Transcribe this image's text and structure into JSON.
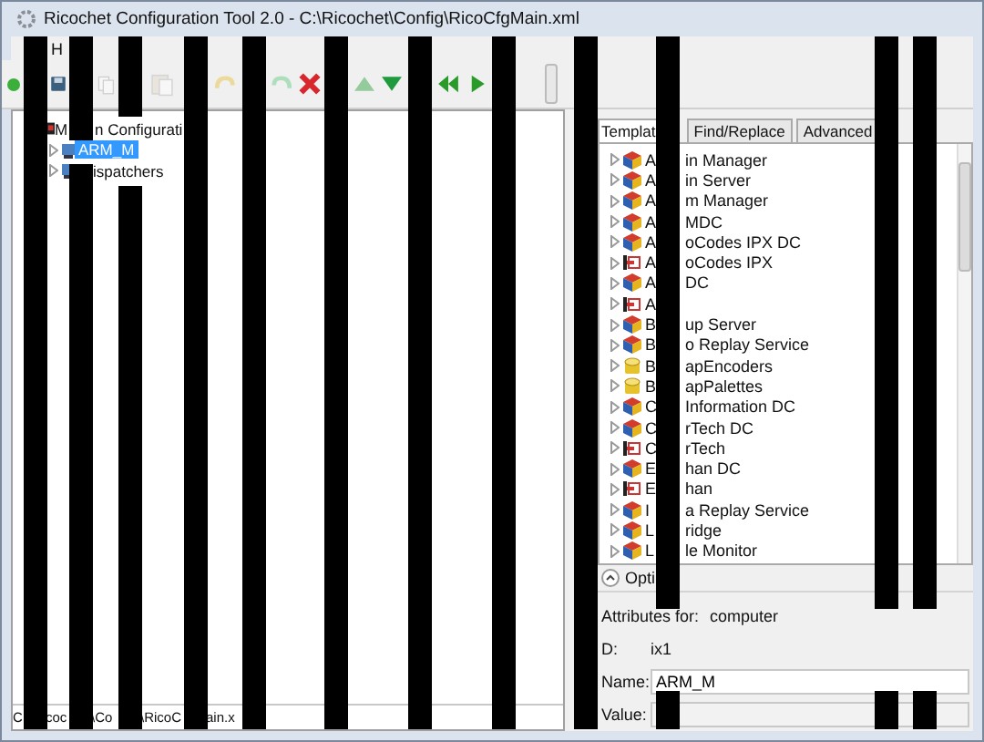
{
  "window": {
    "title": "Ricochet Configuration Tool 2.0 - C:\\Ricochet\\Config\\RicoCfgMain.xml"
  },
  "menu": [
    {
      "label": "H"
    }
  ],
  "toolbar": [
    {
      "kind": "circle",
      "disabled": false
    },
    {
      "kind": "save",
      "disabled": false
    },
    {
      "kind": "copy",
      "disabled": true
    },
    {
      "kind": "paste",
      "disabled": true
    },
    {
      "kind": "undo",
      "disabled": true
    },
    {
      "kind": "redo",
      "disabled": true
    },
    {
      "kind": "delete",
      "disabled": false
    },
    {
      "kind": "up",
      "disabled": true
    },
    {
      "kind": "down",
      "disabled": false
    },
    {
      "kind": "back",
      "disabled": false
    },
    {
      "kind": "next",
      "disabled": false
    }
  ],
  "config_tree": [
    {
      "head": "M",
      "tail": "n Configurati",
      "selected": false,
      "children": [
        {
          "label": "ARM_M",
          "expanded": false,
          "selected": true
        },
        {
          "tail": "ispatchers",
          "expanded": false,
          "selected": false
        }
      ]
    }
  ],
  "tabs": [
    {
      "label": "Templat",
      "selected": true
    },
    {
      "label": "Find/Replace",
      "selected": false
    },
    {
      "label": "Advanced",
      "selected": false
    }
  ],
  "templates": [
    {
      "kind": "cube",
      "head": "A",
      "tail": "in Manager",
      "expanded": false
    },
    {
      "kind": "cube",
      "head": "A",
      "tail": "in Server",
      "expanded": false
    },
    {
      "kind": "cube",
      "head": "A",
      "tail": "m Manager",
      "expanded": false
    },
    {
      "kind": "cube",
      "head": "A",
      "tail": "MDC",
      "expanded": false
    },
    {
      "kind": "cube",
      "head": "A",
      "tail": "oCodes IPX DC",
      "expanded": false
    },
    {
      "kind": "link",
      "head": "A",
      "tail": "oCodes IPX",
      "expanded": false
    },
    {
      "kind": "cube",
      "head": "A",
      "tail": "DC",
      "expanded": false
    },
    {
      "kind": "link",
      "head": "A",
      "expanded": false
    },
    {
      "kind": "cube",
      "head": "B",
      "tail": "up Server",
      "expanded": false
    },
    {
      "kind": "cube",
      "head": "B",
      "tail": "o Replay Service",
      "expanded": false
    },
    {
      "kind": "cylinder",
      "head": "B",
      "tail": "apEncoders",
      "expanded": false
    },
    {
      "kind": "cylinder",
      "head": "B",
      "tail": "apPalettes",
      "expanded": false
    },
    {
      "kind": "cube",
      "head": "C",
      "tail": "Information DC",
      "expanded": false
    },
    {
      "kind": "cube",
      "head": "C",
      "tail": "rTech DC",
      "expanded": false
    },
    {
      "kind": "link",
      "head": "C",
      "tail": "rTech",
      "expanded": false
    },
    {
      "kind": "cube",
      "head": "E",
      "tail": "han DC",
      "expanded": false
    },
    {
      "kind": "link",
      "head": "E",
      "tail": "han",
      "expanded": false
    },
    {
      "kind": "cube",
      "head": "I",
      "tail": "a Replay Service",
      "expanded": false
    },
    {
      "kind": "cube",
      "head": "L",
      "tail": "ridge",
      "expanded": false
    },
    {
      "kind": "cube",
      "head": "L",
      "tail": "le Monitor",
      "expanded": false
    }
  ],
  "options": {
    "label": "Opti",
    "expanded": false
  },
  "attributes": {
    "heading": "Attributes for:",
    "object": "computer",
    "id_label": "D:",
    "id_value": "ix1",
    "name_label": "Name:",
    "name_value": "ARM_M",
    "value_label": "Value:",
    "value_disabled": true
  },
  "status_bar": {
    "parts": [
      "C",
      "coc",
      "\\Co",
      "\\RicoC",
      "ain.x"
    ]
  }
}
